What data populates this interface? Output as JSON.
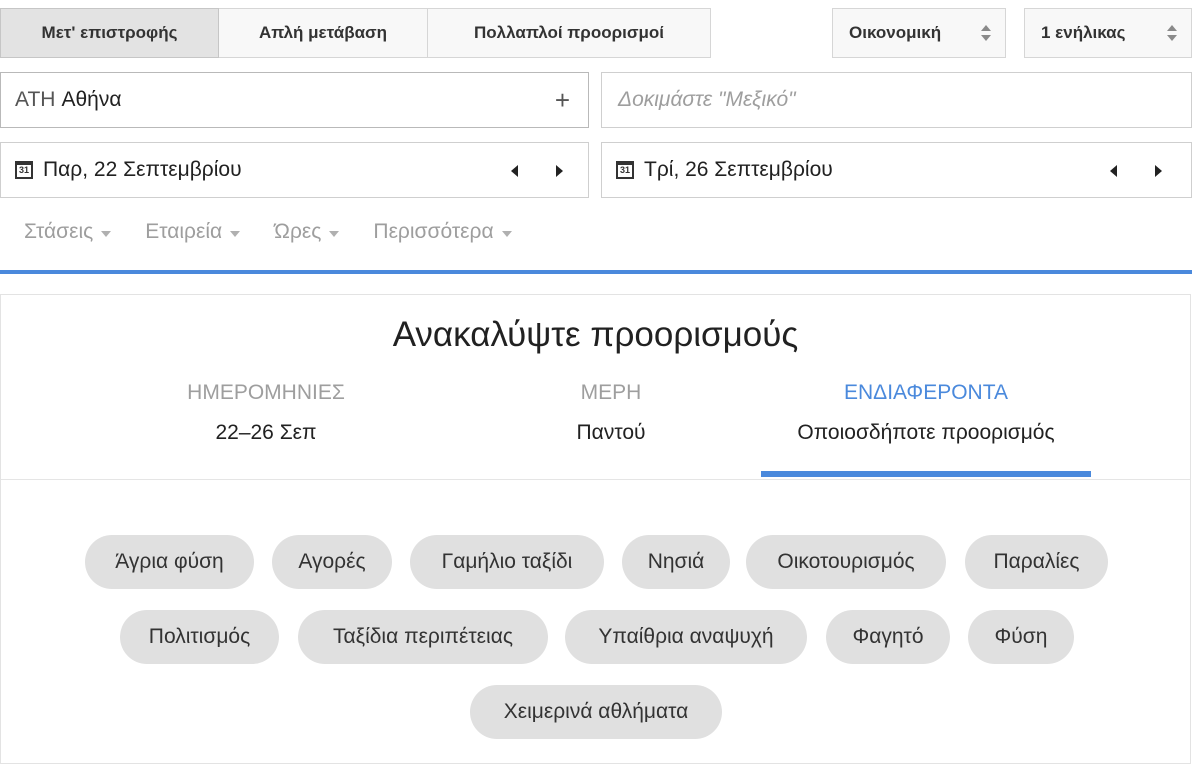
{
  "trip_types": [
    "Μετ' επιστροφής",
    "Απλή μετάβαση",
    "Πολλαπλοί προορισμοί"
  ],
  "cabin_class": "Οικονομική",
  "passengers": "1 ενήλικας",
  "origin": {
    "code": "ATH",
    "city": "Αθήνα",
    "add_symbol": "+"
  },
  "destination": {
    "placeholder": "Δοκιμάστε \"Μεξικό\""
  },
  "calendar_icon_day": "31",
  "depart_date": "Παρ, 22 Σεπτεμβρίου",
  "return_date": "Τρί, 26 Σεπτεμβρίου",
  "filters": [
    "Στάσεις",
    "Εταιρεία",
    "Ώρες",
    "Περισσότερα"
  ],
  "explore": {
    "title": "Ανακαλύψτε προορισμούς",
    "tabs": [
      {
        "label": "ΗΜΕΡΟΜΗΝΙΕΣ",
        "value": "22–26 Σεπ"
      },
      {
        "label": "ΜΕΡΗ",
        "value": "Παντού"
      },
      {
        "label": "ΕΝΔΙΑΦΕΡΟΝΤΑ",
        "value": "Οποιοσδήποτε προορισμός"
      }
    ],
    "interests": [
      "Άγρια φύση",
      "Αγορές",
      "Γαμήλιο ταξίδι",
      "Νησιά",
      "Οικοτουρισμός",
      "Παραλίες",
      "Πολιτισμός",
      "Ταξίδια περιπέτειας",
      "Υπαίθρια αναψυχή",
      "Φαγητό",
      "Φύση",
      "Χειμερινά αθλήματα"
    ]
  },
  "colors": {
    "accent": "#4a89dc",
    "chip": "#e0e0e0"
  }
}
